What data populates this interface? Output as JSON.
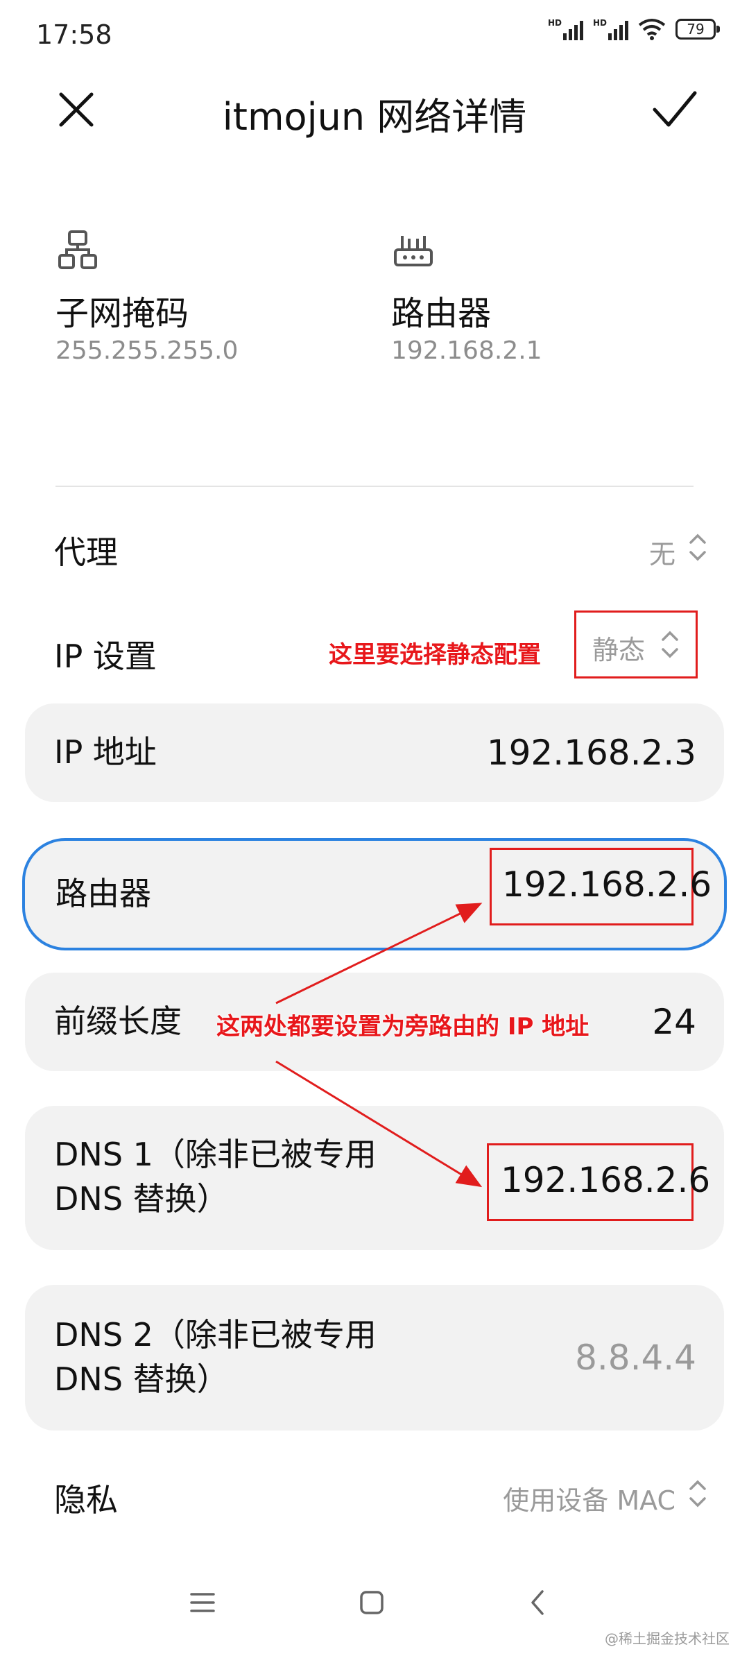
{
  "status": {
    "time": "17:58",
    "battery": "79",
    "hd1": "HD",
    "hd2": "HD"
  },
  "header": {
    "title": "itmojun 网络详情"
  },
  "info": {
    "subnet": {
      "label": "子网掩码",
      "value": "255.255.255.0"
    },
    "router": {
      "label": "路由器",
      "value": "192.168.2.1"
    }
  },
  "rows": {
    "proxy": {
      "label": "代理",
      "value": "无"
    },
    "ip_settings": {
      "label": "IP 设置",
      "value": "静态"
    },
    "ip_address": {
      "label": "IP 地址",
      "value": "192.168.2.3"
    },
    "gateway": {
      "label": "路由器",
      "value": "192.168.2.6"
    },
    "prefix": {
      "label": "前缀长度",
      "value": "24"
    },
    "dns1": {
      "label_line1": "DNS 1（除非已被专用",
      "label_line2": "DNS 替换）",
      "value": "192.168.2.6"
    },
    "dns2": {
      "label_line1": "DNS 2（除非已被专用",
      "label_line2": "DNS 替换）",
      "value": "8.8.4.4"
    },
    "privacy": {
      "label": "隐私",
      "value": "使用设备 MAC"
    }
  },
  "annotations": {
    "static_note": "这里要选择静态配置",
    "bypass_note": "这两处都要设置为旁路由的 IP 地址"
  },
  "footer": {
    "watermark": "@稀土掘金技术社区"
  },
  "colors": {
    "accent_blue": "#2c82e0",
    "annotation_red": "#e8171b",
    "card_bg": "#f2f2f2"
  }
}
